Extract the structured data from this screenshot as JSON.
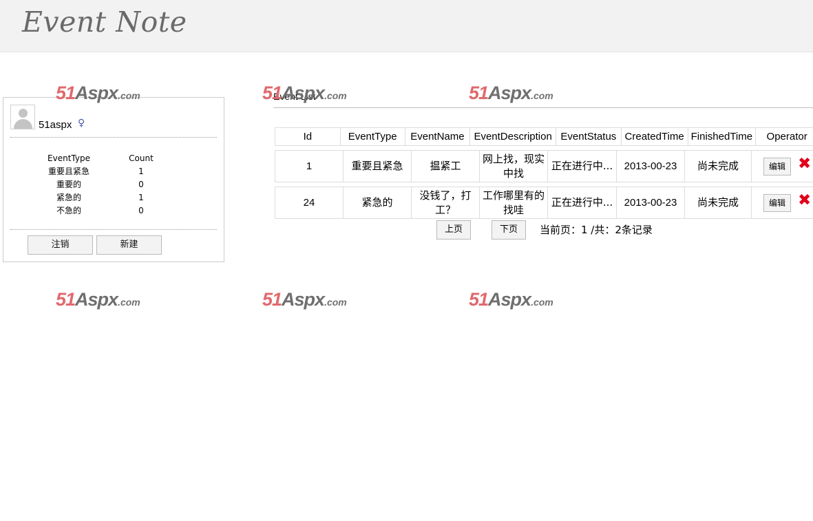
{
  "app": {
    "logo": "Event Note"
  },
  "watermark": {
    "num": "51",
    "brand": "Aspx",
    "suffix": ".com"
  },
  "user": {
    "name": "51aspx",
    "gender_icon": "female-icon"
  },
  "stats": {
    "headers": {
      "type": "EventType",
      "count": "Count"
    },
    "rows": [
      {
        "type": "重要且紧急",
        "count": "1"
      },
      {
        "type": "重要的",
        "count": "0"
      },
      {
        "type": "紧急的",
        "count": "1"
      },
      {
        "type": "不急的",
        "count": "0"
      }
    ]
  },
  "buttons": {
    "logout": "注销",
    "new": "新建"
  },
  "list": {
    "title": "Event List",
    "columns": [
      "Id",
      "EventType",
      "EventName",
      "EventDescription",
      "EventStatus",
      "CreatedTime",
      "FinishedTime",
      "Operator"
    ],
    "rows": [
      {
        "id": "1",
        "type": "重要且紧急",
        "name": "揾紧工",
        "desc": "网上找，现实中找",
        "status": "正在进行中...",
        "created": "2013-00-23",
        "finished": "尚未完成",
        "edit": "编辑"
      },
      {
        "id": "24",
        "type": "紧急的",
        "name": "没钱了，打工？",
        "desc": "工作哪里有的找哇",
        "status": "正在进行中...",
        "created": "2013-00-23",
        "finished": "尚未完成",
        "edit": "编辑"
      }
    ]
  },
  "pager": {
    "prev": "上页",
    "next": "下页",
    "info": "当前页：1 /共：2条记录"
  },
  "colors": {
    "header_bg": "#f2f2f2",
    "delete": "#e2001a",
    "watermark_red": "#e0696d"
  }
}
